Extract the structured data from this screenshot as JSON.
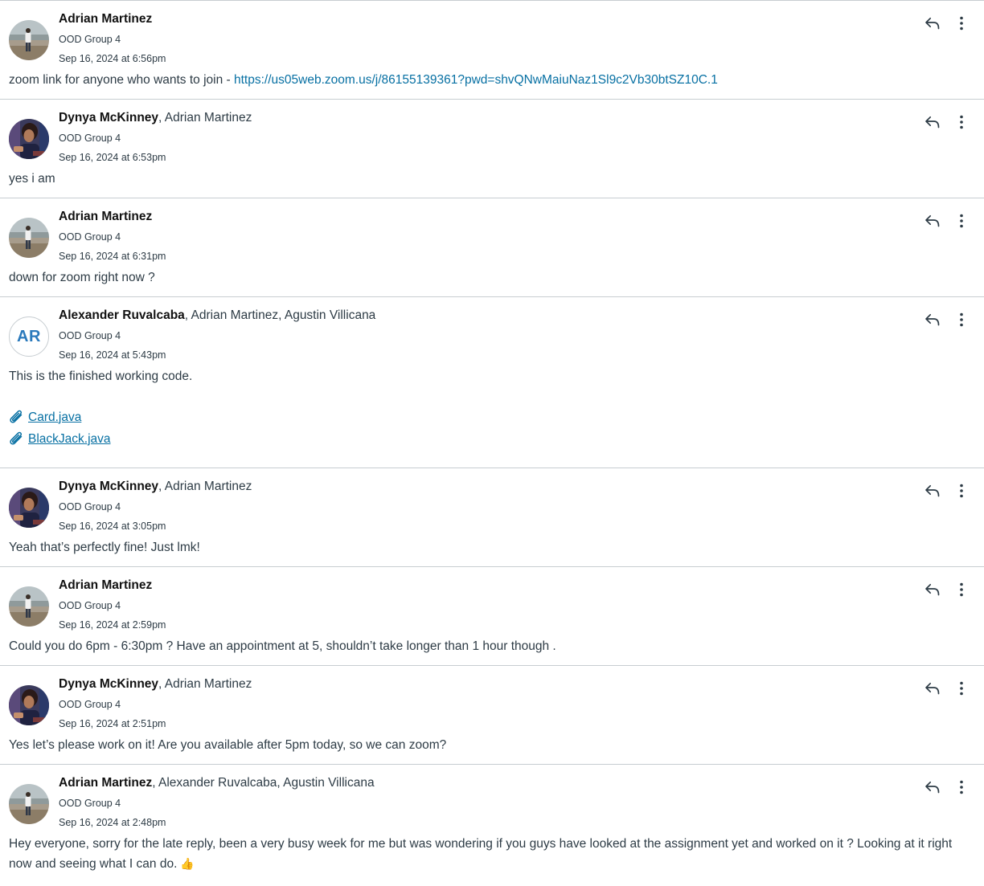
{
  "messages": [
    {
      "author": "Adrian Martinez",
      "others": "",
      "context": "OOD Group 4",
      "date": "Sep 16, 2024 at 6:56pm",
      "avatar": "photo-beach",
      "body": "zoom link for anyone who wants to join - ",
      "link": "https://us05web.zoom.us/j/86155139361?pwd=shvQNwMaiuNaz1Sl9c2Vb30btSZ10C.1"
    },
    {
      "author": "Dynya McKinney",
      "others": ", Adrian Martinez",
      "context": "OOD Group 4",
      "date": "Sep 16, 2024 at 6:53pm",
      "avatar": "photo-portrait",
      "body": "yes i am"
    },
    {
      "author": "Adrian Martinez",
      "others": "",
      "context": "OOD Group 4",
      "date": "Sep 16, 2024 at 6:31pm",
      "avatar": "photo-beach",
      "body": "down for zoom right now ?"
    },
    {
      "author": "Alexander Ruvalcaba",
      "others": ", Adrian Martinez, Agustin Villicana",
      "context": "OOD Group 4",
      "date": "Sep 16, 2024 at 5:43pm",
      "avatar": "initials",
      "initials": "AR",
      "body": "This is the finished working code.",
      "attachments": [
        "Card.java",
        "BlackJack.java"
      ]
    },
    {
      "author": "Dynya McKinney",
      "others": ", Adrian Martinez",
      "context": "OOD Group 4",
      "date": "Sep 16, 2024 at 3:05pm",
      "avatar": "photo-portrait",
      "body": "Yeah that’s perfectly fine! Just lmk!"
    },
    {
      "author": "Adrian Martinez",
      "others": "",
      "context": "OOD Group 4",
      "date": "Sep 16, 2024 at 2:59pm",
      "avatar": "photo-beach",
      "body": "Could you do 6pm - 6:30pm ? Have an appointment at 5, shouldn’t take longer than 1 hour though ."
    },
    {
      "author": "Dynya McKinney",
      "others": ", Adrian Martinez",
      "context": "OOD Group 4",
      "date": "Sep 16, 2024 at 2:51pm",
      "avatar": "photo-portrait",
      "body": "Yes let’s please work on it! Are you available after 5pm today, so we can zoom?"
    },
    {
      "author": "Adrian Martinez",
      "others": ", Alexander Ruvalcaba, Agustin Villicana",
      "context": "OOD Group 4",
      "date": "Sep 16, 2024 at 2:48pm",
      "avatar": "photo-beach",
      "body": "Hey everyone, sorry for the late reply, been a very busy week for me but was wondering if you guys have looked at the assignment yet and worked on it ? Looking at it right now and seeing what I can do.",
      "emoji": "👍"
    }
  ],
  "icons": {
    "reply": "reply-icon",
    "more": "more-options-icon",
    "attachment": "paperclip-icon"
  },
  "colors": {
    "link": "#0770a3",
    "initials": "#2b7abc",
    "divider": "#c7cdd1"
  }
}
